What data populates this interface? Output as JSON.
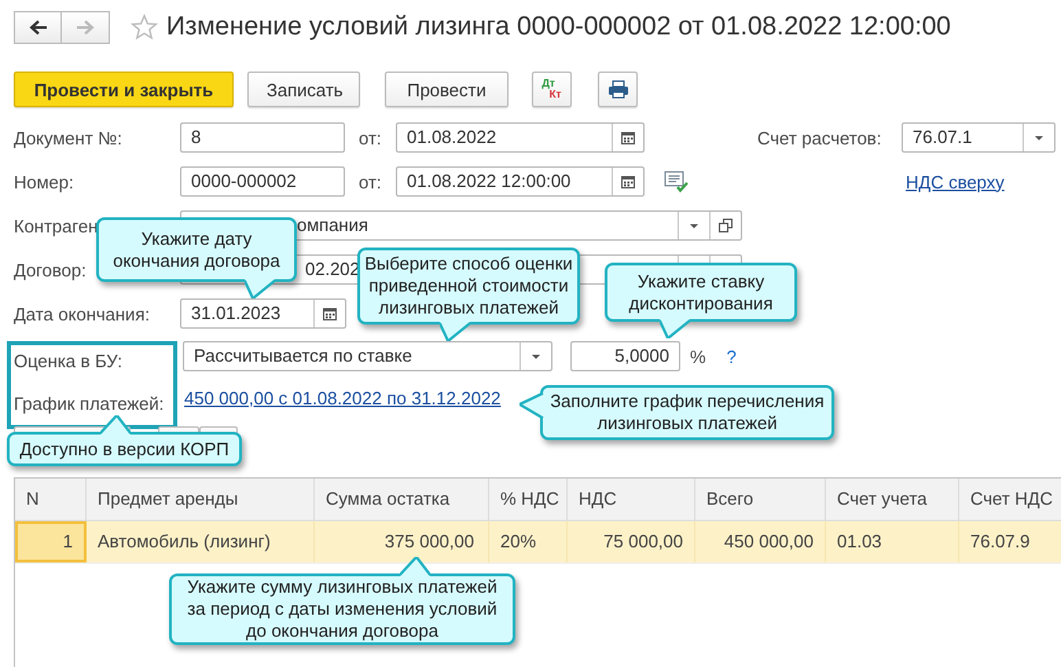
{
  "title": "Изменение условий лизинга 0000-000002 от 01.08.2022 12:00:00",
  "toolbar": [
    {
      "kind": "primary",
      "label": "Провести и закрыть"
    },
    {
      "kind": "text",
      "label": "Записать"
    },
    {
      "kind": "text",
      "label": "Провести"
    },
    {
      "kind": "dtkt",
      "debit": "Дт",
      "credit": "Кт"
    },
    {
      "kind": "print"
    }
  ],
  "form": {
    "document_number": {
      "label": "Документ №:",
      "value": "8",
      "date_label": "от:",
      "date": "01.08.2022"
    },
    "settlement_account": {
      "label": "Счет расчетов:",
      "value": "76.07.1"
    },
    "number": {
      "label": "Номер:",
      "value": "0000-000002",
      "date_label": "от:",
      "date": "01.08.2022 12:00:00"
    },
    "vat_link": "НДС сверху",
    "counterparty": {
      "label": "Контраген",
      "value": "омпания"
    },
    "contract": {
      "label": "Договор:",
      "value": "02.202"
    },
    "end_date": {
      "label": "Дата окончания:",
      "value": "31.01.2023"
    },
    "valuation": {
      "label": "Оценка в БУ:",
      "value": "Рассчитывается по ставке",
      "rate": "5,0000",
      "unit": "%",
      "help": "?"
    },
    "schedule": {
      "label": "График платежей:",
      "link": "450 000,00 с 01.08.2022 по 31.12.2022"
    }
  },
  "table": {
    "columns": [
      "N",
      "Предмет аренды",
      "Сумма остатка",
      "% НДС",
      "НДС",
      "Всего",
      "Счет учета",
      "Счет НДС"
    ],
    "rows": [
      {
        "selected": true,
        "cells": [
          "1",
          "Автомобиль (лизинг)",
          "375 000,00",
          "20%",
          "75 000,00",
          "450 000,00",
          "01.03",
          "76.07.9"
        ]
      }
    ]
  },
  "callouts": [
    {
      "kind": "down",
      "text": "Укажите дату\nокончания договора"
    },
    {
      "kind": "down",
      "text": "Выберите способ оценки\nприведенной стоимости\nлизинговых платежей"
    },
    {
      "kind": "down",
      "text": "Укажите ставку\nдисконтирования"
    },
    {
      "kind": "left",
      "text": "Заполните график перечисления\nлизинговых платежей"
    },
    {
      "kind": "up",
      "text": "Доступно в версии КОРП"
    },
    {
      "kind": "up",
      "text": "Укажите сумму лизинговых платежей\nза период с даты изменения условий\nдо окончания договора"
    }
  ]
}
